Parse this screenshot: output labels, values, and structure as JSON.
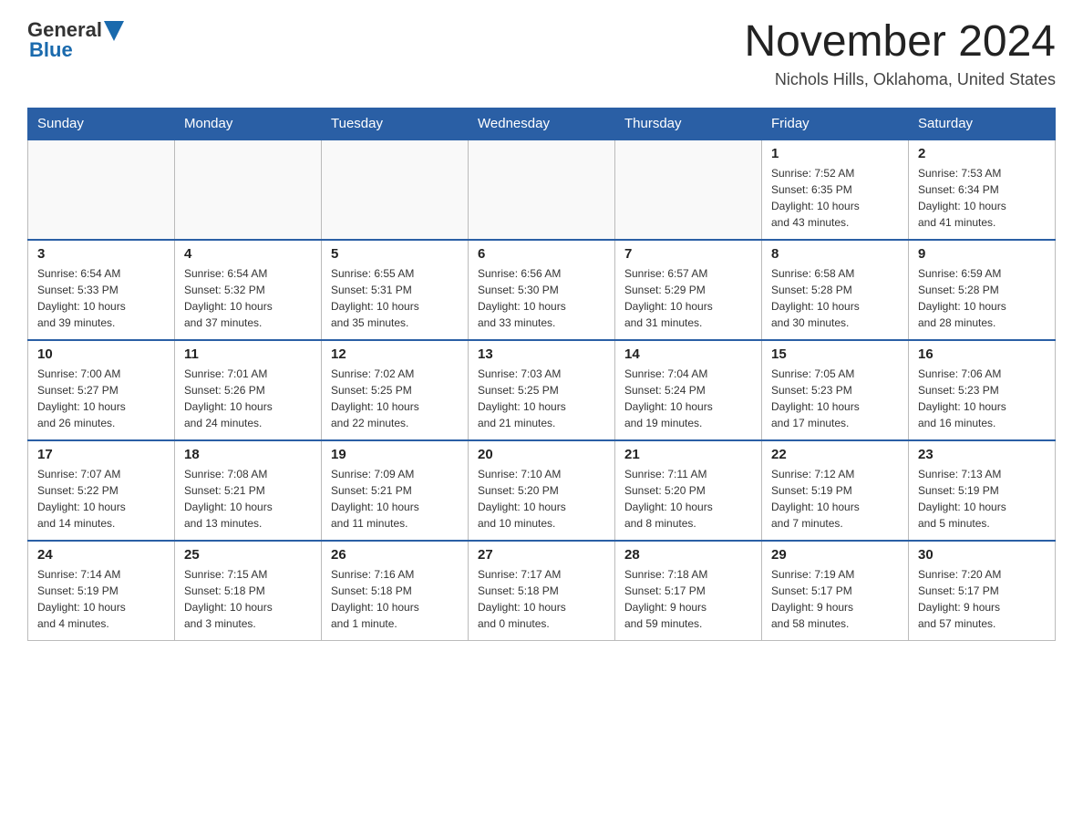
{
  "header": {
    "logo_general": "General",
    "logo_blue": "Blue",
    "month_title": "November 2024",
    "location": "Nichols Hills, Oklahoma, United States"
  },
  "weekdays": [
    "Sunday",
    "Monday",
    "Tuesday",
    "Wednesday",
    "Thursday",
    "Friday",
    "Saturday"
  ],
  "weeks": [
    [
      {
        "day": "",
        "info": ""
      },
      {
        "day": "",
        "info": ""
      },
      {
        "day": "",
        "info": ""
      },
      {
        "day": "",
        "info": ""
      },
      {
        "day": "",
        "info": ""
      },
      {
        "day": "1",
        "info": "Sunrise: 7:52 AM\nSunset: 6:35 PM\nDaylight: 10 hours\nand 43 minutes."
      },
      {
        "day": "2",
        "info": "Sunrise: 7:53 AM\nSunset: 6:34 PM\nDaylight: 10 hours\nand 41 minutes."
      }
    ],
    [
      {
        "day": "3",
        "info": "Sunrise: 6:54 AM\nSunset: 5:33 PM\nDaylight: 10 hours\nand 39 minutes."
      },
      {
        "day": "4",
        "info": "Sunrise: 6:54 AM\nSunset: 5:32 PM\nDaylight: 10 hours\nand 37 minutes."
      },
      {
        "day": "5",
        "info": "Sunrise: 6:55 AM\nSunset: 5:31 PM\nDaylight: 10 hours\nand 35 minutes."
      },
      {
        "day": "6",
        "info": "Sunrise: 6:56 AM\nSunset: 5:30 PM\nDaylight: 10 hours\nand 33 minutes."
      },
      {
        "day": "7",
        "info": "Sunrise: 6:57 AM\nSunset: 5:29 PM\nDaylight: 10 hours\nand 31 minutes."
      },
      {
        "day": "8",
        "info": "Sunrise: 6:58 AM\nSunset: 5:28 PM\nDaylight: 10 hours\nand 30 minutes."
      },
      {
        "day": "9",
        "info": "Sunrise: 6:59 AM\nSunset: 5:28 PM\nDaylight: 10 hours\nand 28 minutes."
      }
    ],
    [
      {
        "day": "10",
        "info": "Sunrise: 7:00 AM\nSunset: 5:27 PM\nDaylight: 10 hours\nand 26 minutes."
      },
      {
        "day": "11",
        "info": "Sunrise: 7:01 AM\nSunset: 5:26 PM\nDaylight: 10 hours\nand 24 minutes."
      },
      {
        "day": "12",
        "info": "Sunrise: 7:02 AM\nSunset: 5:25 PM\nDaylight: 10 hours\nand 22 minutes."
      },
      {
        "day": "13",
        "info": "Sunrise: 7:03 AM\nSunset: 5:25 PM\nDaylight: 10 hours\nand 21 minutes."
      },
      {
        "day": "14",
        "info": "Sunrise: 7:04 AM\nSunset: 5:24 PM\nDaylight: 10 hours\nand 19 minutes."
      },
      {
        "day": "15",
        "info": "Sunrise: 7:05 AM\nSunset: 5:23 PM\nDaylight: 10 hours\nand 17 minutes."
      },
      {
        "day": "16",
        "info": "Sunrise: 7:06 AM\nSunset: 5:23 PM\nDaylight: 10 hours\nand 16 minutes."
      }
    ],
    [
      {
        "day": "17",
        "info": "Sunrise: 7:07 AM\nSunset: 5:22 PM\nDaylight: 10 hours\nand 14 minutes."
      },
      {
        "day": "18",
        "info": "Sunrise: 7:08 AM\nSunset: 5:21 PM\nDaylight: 10 hours\nand 13 minutes."
      },
      {
        "day": "19",
        "info": "Sunrise: 7:09 AM\nSunset: 5:21 PM\nDaylight: 10 hours\nand 11 minutes."
      },
      {
        "day": "20",
        "info": "Sunrise: 7:10 AM\nSunset: 5:20 PM\nDaylight: 10 hours\nand 10 minutes."
      },
      {
        "day": "21",
        "info": "Sunrise: 7:11 AM\nSunset: 5:20 PM\nDaylight: 10 hours\nand 8 minutes."
      },
      {
        "day": "22",
        "info": "Sunrise: 7:12 AM\nSunset: 5:19 PM\nDaylight: 10 hours\nand 7 minutes."
      },
      {
        "day": "23",
        "info": "Sunrise: 7:13 AM\nSunset: 5:19 PM\nDaylight: 10 hours\nand 5 minutes."
      }
    ],
    [
      {
        "day": "24",
        "info": "Sunrise: 7:14 AM\nSunset: 5:19 PM\nDaylight: 10 hours\nand 4 minutes."
      },
      {
        "day": "25",
        "info": "Sunrise: 7:15 AM\nSunset: 5:18 PM\nDaylight: 10 hours\nand 3 minutes."
      },
      {
        "day": "26",
        "info": "Sunrise: 7:16 AM\nSunset: 5:18 PM\nDaylight: 10 hours\nand 1 minute."
      },
      {
        "day": "27",
        "info": "Sunrise: 7:17 AM\nSunset: 5:18 PM\nDaylight: 10 hours\nand 0 minutes."
      },
      {
        "day": "28",
        "info": "Sunrise: 7:18 AM\nSunset: 5:17 PM\nDaylight: 9 hours\nand 59 minutes."
      },
      {
        "day": "29",
        "info": "Sunrise: 7:19 AM\nSunset: 5:17 PM\nDaylight: 9 hours\nand 58 minutes."
      },
      {
        "day": "30",
        "info": "Sunrise: 7:20 AM\nSunset: 5:17 PM\nDaylight: 9 hours\nand 57 minutes."
      }
    ]
  ]
}
